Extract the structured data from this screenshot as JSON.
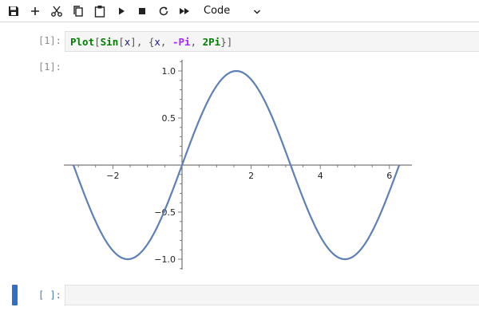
{
  "toolbar": {
    "buttons": [
      {
        "name": "save-icon"
      },
      {
        "name": "add-cell-icon"
      },
      {
        "name": "cut-icon"
      },
      {
        "name": "copy-icon"
      },
      {
        "name": "paste-icon"
      },
      {
        "name": "run-icon"
      },
      {
        "name": "stop-icon"
      },
      {
        "name": "restart-icon"
      },
      {
        "name": "run-all-icon"
      }
    ],
    "cell_type_label": "Code"
  },
  "cells": {
    "input_prompt": "[1]:",
    "output_prompt": "[1]:",
    "code": {
      "fn": "Plot",
      "open1": "[",
      "inner_fn": "Sin",
      "open2": "[",
      "var": "x",
      "close2": "]",
      "sep": ", {",
      "var2": "x",
      "sep2": ", ",
      "neg": "-Pi",
      "sep3": ", ",
      "upper": "2Pi",
      "close": "}]"
    },
    "empty_prompt": "[ ]:"
  },
  "chart_data": {
    "type": "line",
    "function": "sin(x)",
    "xlim": [
      -3.14159,
      6.28319
    ],
    "ylim": [
      -1.0,
      1.0
    ],
    "x_ticks": [
      -2,
      2,
      4,
      6
    ],
    "x_tick_labels": [
      "−2",
      "2",
      "4",
      "6"
    ],
    "y_ticks": [
      -1.0,
      -0.5,
      0.5,
      1.0
    ],
    "y_tick_labels": [
      "−1.0",
      "−0.5",
      "0.5",
      "1.0"
    ],
    "line_color": "#5e81b5",
    "series": [
      {
        "x": [
          -3.1416,
          -2.8274,
          -2.5133,
          -2.1991,
          -1.885,
          -1.5708,
          -1.2566,
          -0.9425,
          -0.6283,
          -0.3142,
          0,
          0.3142,
          0.6283,
          0.9425,
          1.2566,
          1.5708,
          1.885,
          2.1991,
          2.5133,
          2.8274,
          3.1416,
          3.4558,
          3.7699,
          4.0841,
          4.3982,
          4.7124,
          5.0265,
          5.3407,
          5.6549,
          5.969,
          6.2832
        ],
        "y": [
          0,
          -0.309,
          -0.5878,
          -0.809,
          -0.9511,
          -1.0,
          -0.9511,
          -0.809,
          -0.5878,
          -0.309,
          0,
          0.309,
          0.5878,
          0.809,
          0.9511,
          1.0,
          0.9511,
          0.809,
          0.5878,
          0.309,
          0,
          -0.309,
          -0.5878,
          -0.809,
          -0.9511,
          -1.0,
          -0.9511,
          -0.809,
          -0.5878,
          -0.309,
          0
        ]
      }
    ]
  }
}
